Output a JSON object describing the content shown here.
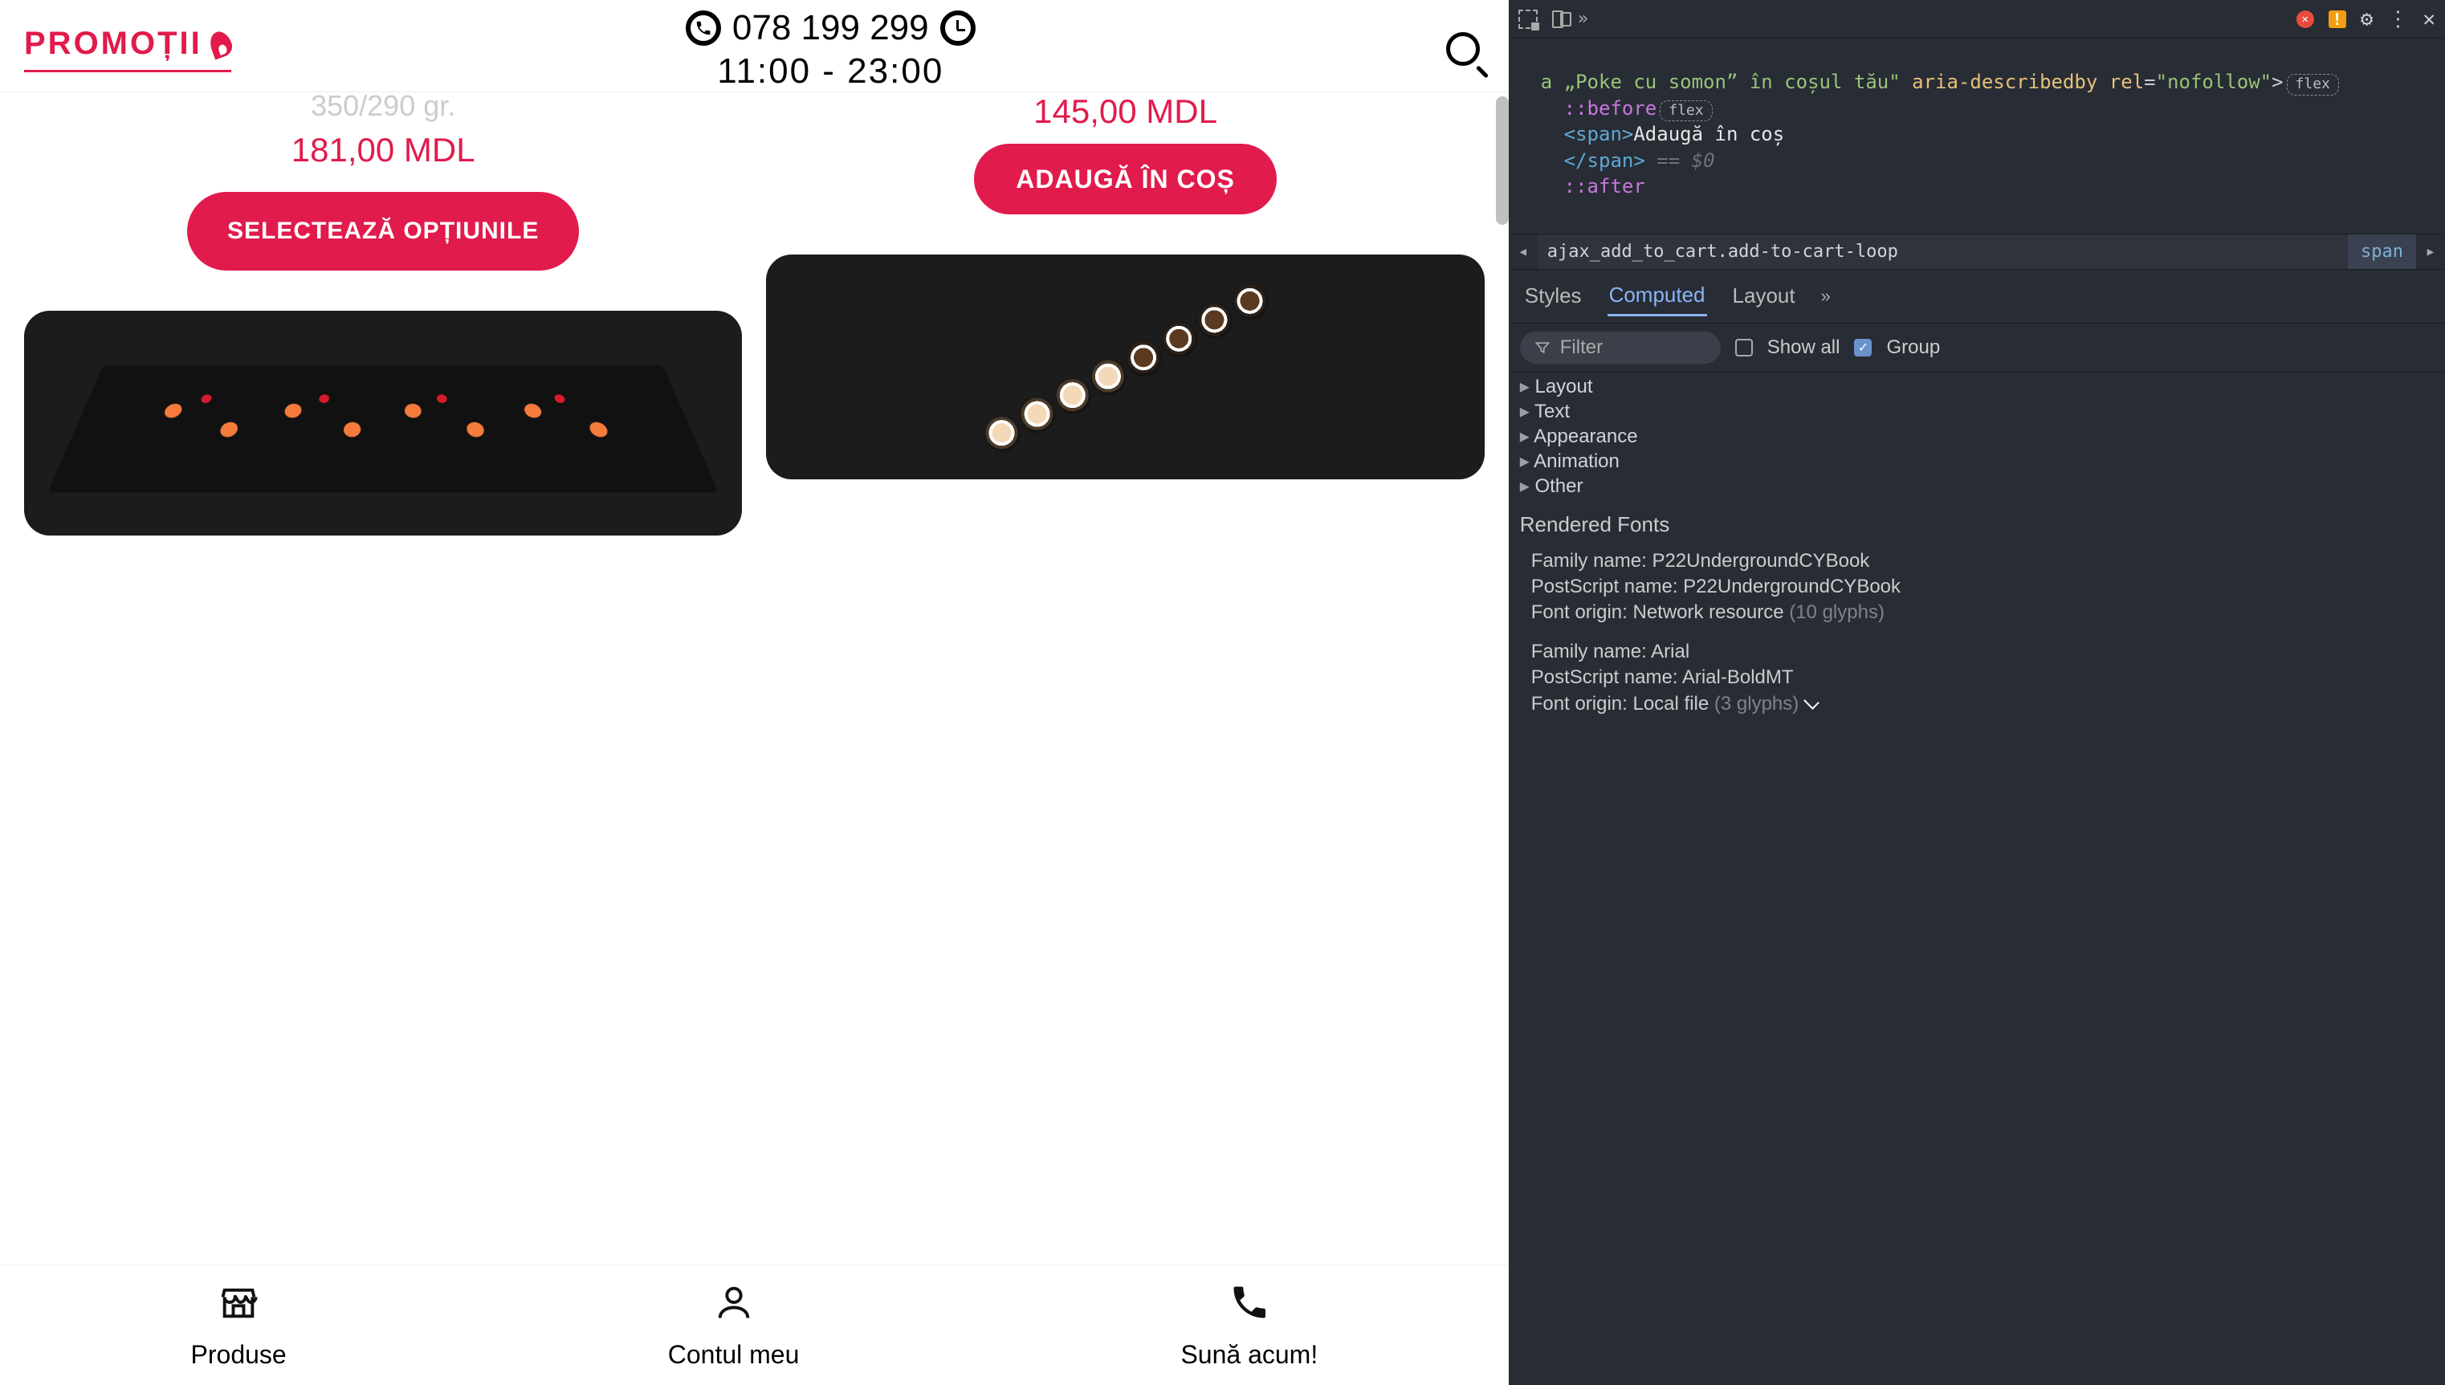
{
  "site": {
    "header": {
      "promo_label": "PROMOȚII",
      "phone": "078 199 299",
      "hours": "11:00 - 23:00"
    },
    "products": {
      "left": {
        "weight": "350/290 gr.",
        "price": "181,00 MDL",
        "button": "SELECTEAZĂ OPȚIUNILE"
      },
      "right": {
        "price": "145,00 MDL",
        "button": "ADAUGĂ ÎN COȘ"
      }
    },
    "footer": {
      "produse": "Produse",
      "contul": "Contul meu",
      "suna": "Sună acum!"
    }
  },
  "devtools": {
    "dom": {
      "frag_pre": "a „Poke cu somon” în coșul tău\"",
      "attr_describedby": "aria-describedby",
      "attr_rel": "rel",
      "rel_val": "\"nofollow\"",
      "before": "::before",
      "span_open": "<span>",
      "span_text": "Adaugă în coș",
      "span_close": "</span>",
      "eq0": "== $0",
      "after": "::after",
      "flex": "flex"
    },
    "breadcrumb": {
      "mid": "ajax_add_to_cart.add-to-cart-loop",
      "end": "span"
    },
    "subtabs": {
      "styles": "Styles",
      "computed": "Computed",
      "layout": "Layout"
    },
    "filter": {
      "placeholder": "Filter",
      "showall": "Show all",
      "group": "Group"
    },
    "groups": [
      "Layout",
      "Text",
      "Appearance",
      "Animation",
      "Other"
    ],
    "fonts": {
      "title": "Rendered Fonts",
      "f1_family_label": "Family name: ",
      "f1_family": "P22UndergroundCYBook",
      "f1_ps_label": "PostScript name: ",
      "f1_ps": "P22UndergroundCYBook",
      "f1_origin_label": "Font origin: ",
      "f1_origin": "Network resource",
      "f1_glyphs": " (10 glyphs)",
      "f2_family_label": "Family name: ",
      "f2_family": "Arial",
      "f2_ps_label": "PostScript name: ",
      "f2_ps": "Arial-BoldMT",
      "f2_origin_label": "Font origin: ",
      "f2_origin": "Local file",
      "f2_glyphs": " (3 glyphs)"
    }
  }
}
